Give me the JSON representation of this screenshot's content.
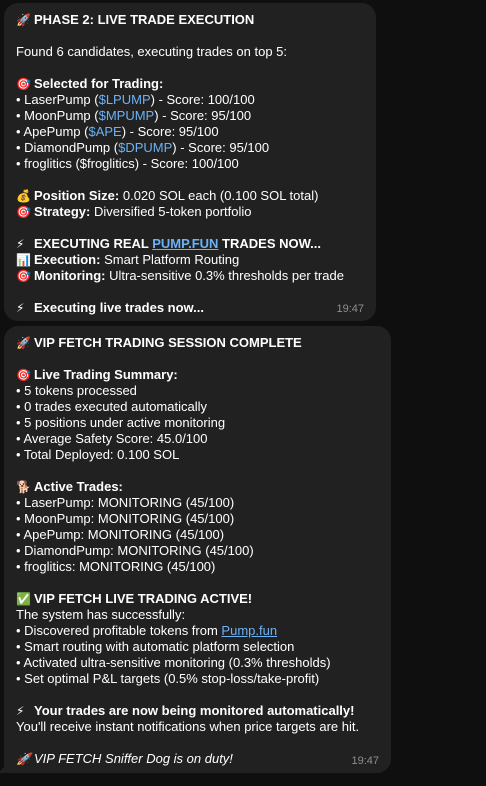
{
  "colors": {
    "background": "#0f0f0f",
    "bubble": "#212121",
    "link": "#6cb2f5",
    "text": "#ffffff",
    "timestamp": "#8f8f8f"
  },
  "msg1": {
    "header_icon": "🚀",
    "header": "PHASE 2: LIVE TRADE EXECUTION",
    "intro": "Found 6 candidates, executing trades on top 5:",
    "selected_icon": "🎯",
    "selected_label": "Selected for Trading:",
    "candidates": [
      {
        "prefix": "• LaserPump (",
        "token": "$LPUMP",
        "suffix": ") - Score: 100/100"
      },
      {
        "prefix": "• MoonPump (",
        "token": "$MPUMP",
        "suffix": ") - Score: 95/100"
      },
      {
        "prefix": "• ApePump (",
        "token": "$APE",
        "suffix": ") - Score: 95/100"
      },
      {
        "prefix": "• DiamondPump (",
        "token": "$DPUMP",
        "suffix": ") - Score: 95/100"
      }
    ],
    "candidate_plain": "• froglitics ($froglitics) - Score: 100/100",
    "position_icon": "💰",
    "position_label": "Position Size:",
    "position_value": " 0.020 SOL each (0.100 SOL total)",
    "strategy_icon": "🎯",
    "strategy_label": "Strategy:",
    "strategy_value": " Diversified 5-token portfolio",
    "exec_icon": "⚡",
    "exec_pre": "EXECUTING REAL ",
    "exec_link": "PUMP.FUN",
    "exec_post": " TRADES NOW...",
    "execution_icon": "📊",
    "execution_label": "Execution:",
    "execution_value": " Smart Platform Routing",
    "monitoring_icon": "🎯",
    "monitoring_label": "Monitoring:",
    "monitoring_value": " Ultra-sensitive 0.3% thresholds per trade",
    "live_icon": "⚡",
    "live": "Executing live trades now...",
    "time": "19:47"
  },
  "msg2": {
    "header_icon": "🚀",
    "header": "VIP FETCH TRADING SESSION COMPLETE",
    "summary_icon": "🎯",
    "summary_label": "Live Trading Summary:",
    "summary_items": [
      "• 5 tokens processed",
      "• 0 trades executed automatically",
      "• 5 positions under active monitoring",
      "• Average Safety Score: 45.0/100",
      "• Total Deployed: 0.100 SOL"
    ],
    "active_icon": "🐕",
    "active_label": "Active Trades:",
    "active_items": [
      "• LaserPump: MONITORING (45/100)",
      "• MoonPump: MONITORING (45/100)",
      "• ApePump: MONITORING (45/100)",
      "• DiamondPump: MONITORING (45/100)",
      "• froglitics: MONITORING (45/100)"
    ],
    "live_icon": "✅",
    "live_header": "VIP FETCH LIVE TRADING ACTIVE!",
    "system_text": "The system has successfully:",
    "discovered_pre": "• Discovered profitable tokens from ",
    "discovered_link": "Pump.fun",
    "list_items": [
      "• Smart routing with automatic platform selection",
      "• Activated ultra-sensitive monitoring (0.3% thresholds)",
      "• Set optimal P&L targets (0.5% stop-loss/take-profit)"
    ],
    "monitored_icon": "⚡",
    "monitored": "Your trades are now being monitored automatically!",
    "notify": "You'll receive instant notifications when price targets are hit.",
    "sniffer_icon": "🚀",
    "sniffer": "VIP FETCH Sniffer Dog is on duty!",
    "time": "19:47"
  }
}
